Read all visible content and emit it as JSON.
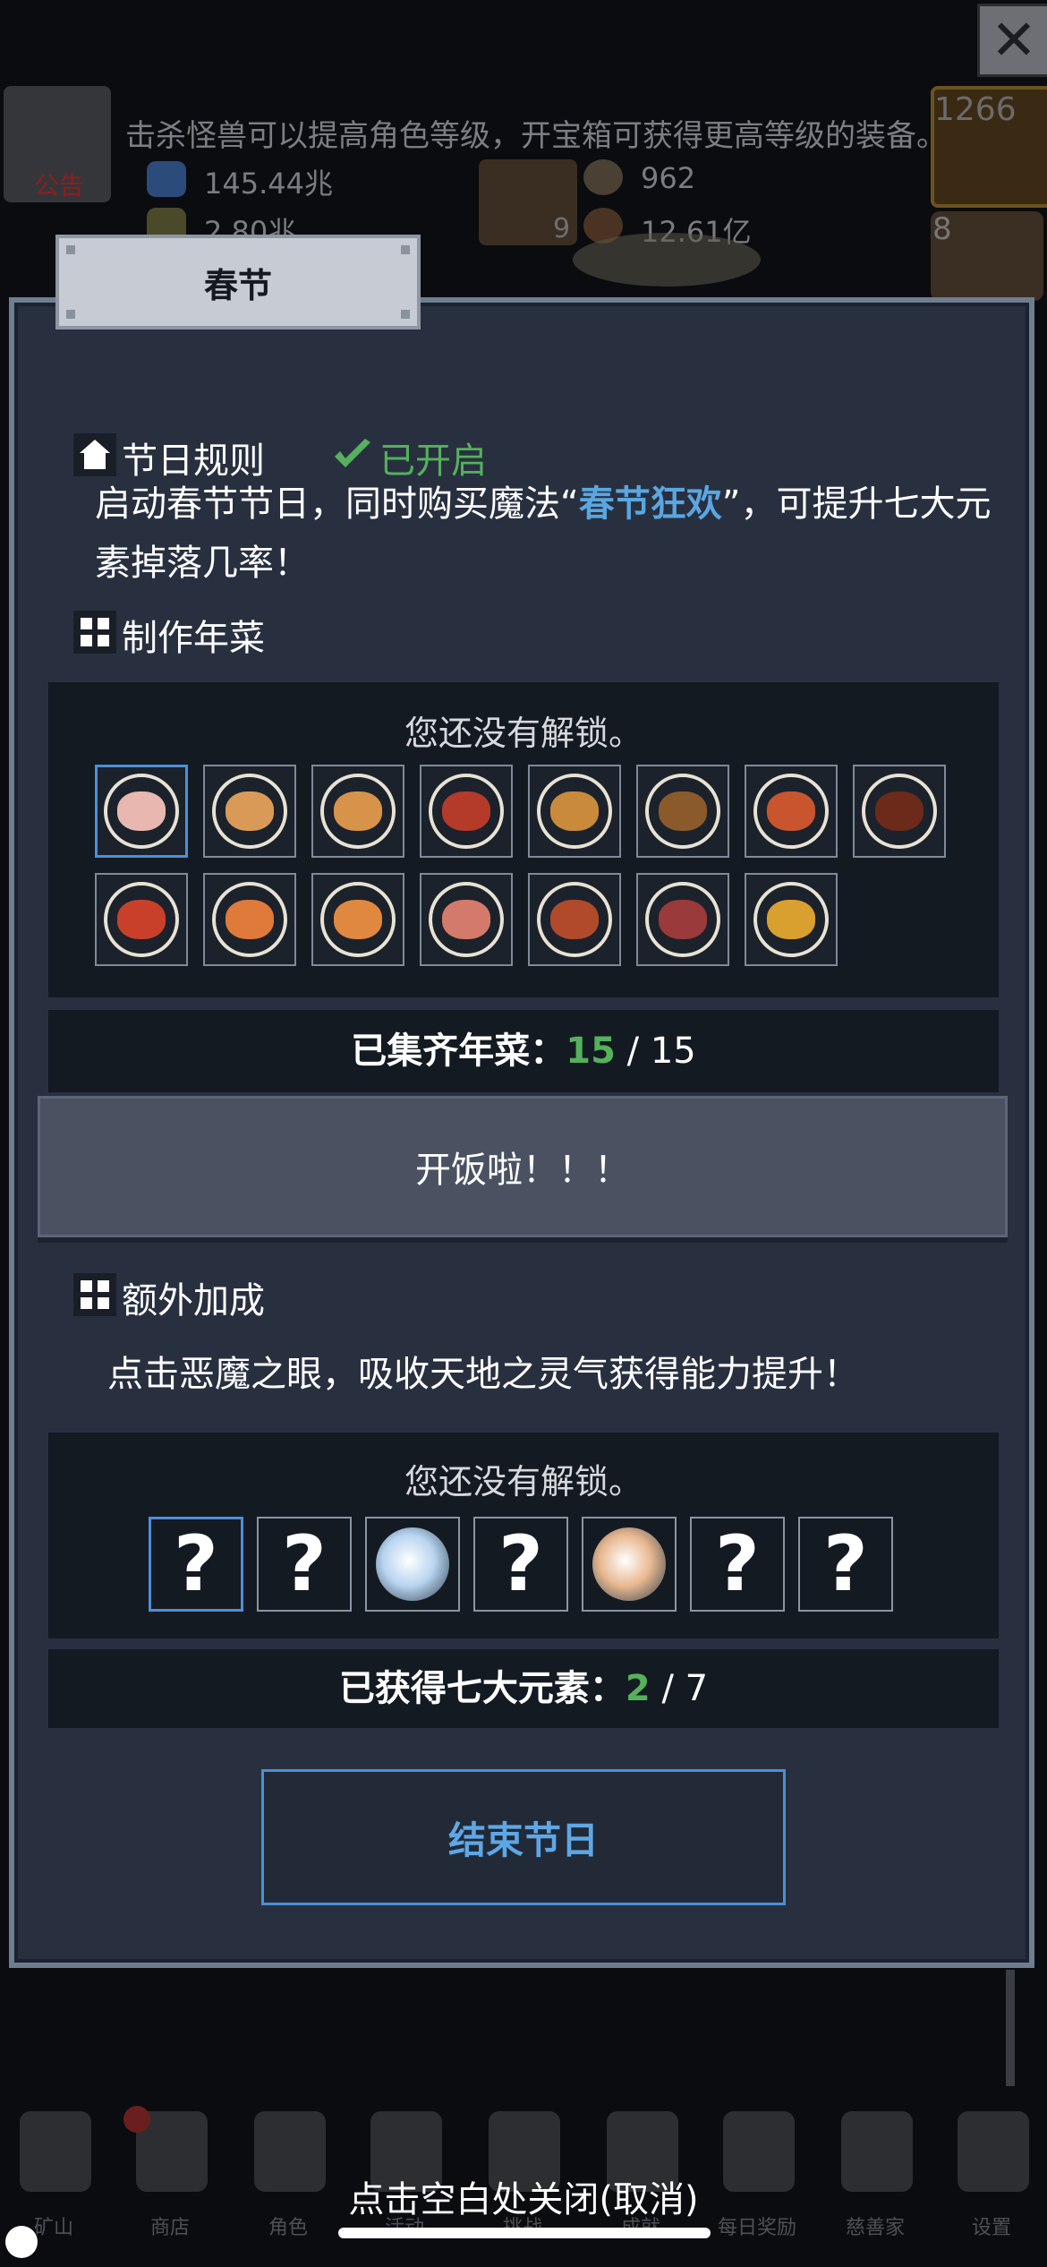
{
  "hud": {
    "tip": "击杀怪兽可以提高角色等级，开宝箱可获得更高等级的装备。",
    "notice_label": "公告",
    "res1": "145.44兆",
    "res2": "2.80兆",
    "res3": "962",
    "res4": "12.61亿",
    "book_count": "9",
    "potion_count": "1266",
    "chest_count": "8",
    "close_label": "✕"
  },
  "modal": {
    "title": "春节",
    "rules": {
      "title": "节日规则",
      "status": "已开启",
      "text_before": "启动春节节日，同时购买魔法",
      "quote_open": "“",
      "highlight": "春节狂欢",
      "quote_close": "”",
      "text_after": "，可提升七大元素掉落几率！"
    },
    "dishes": {
      "title": "制作年菜",
      "locked_text": "您还没有解锁。",
      "count_label": "已集齐年菜：",
      "count_current": "15",
      "count_sep": " / ",
      "count_total": "15",
      "items": [
        {
          "name": "bun",
          "color": "#e8b8b0"
        },
        {
          "name": "dumplings-steamed",
          "color": "#d99a58"
        },
        {
          "name": "xiaolongbao",
          "color": "#d7934a"
        },
        {
          "name": "red-braise",
          "color": "#b43a2a"
        },
        {
          "name": "meatballs",
          "color": "#c98a3c"
        },
        {
          "name": "stir-fry-greens",
          "color": "#8a5a2a"
        },
        {
          "name": "shrimp-plate",
          "color": "#c8552e"
        },
        {
          "name": "braised-pork",
          "color": "#6b2a1a"
        },
        {
          "name": "tomato-dish",
          "color": "#c9402a"
        },
        {
          "name": "prawns",
          "color": "#e07a3a"
        },
        {
          "name": "pumpkin-soup",
          "color": "#e08840"
        },
        {
          "name": "shrimp-soup",
          "color": "#d47a6a"
        },
        {
          "name": "fish-stew",
          "color": "#b04a2a"
        },
        {
          "name": "steamed-fish",
          "color": "#9a3a3a"
        },
        {
          "name": "golden-soup",
          "color": "#d9a030"
        }
      ],
      "cook_button": "开饭啦！！！"
    },
    "bonus": {
      "title": "额外加成",
      "text": "点击恶魔之眼，吸收天地之灵气获得能力提升！",
      "locked_text": "您还没有解锁。",
      "unknown_mark": "?",
      "elements": [
        {
          "state": "unknown"
        },
        {
          "state": "unknown"
        },
        {
          "state": "owned",
          "color": "#b8d4f0"
        },
        {
          "state": "unknown"
        },
        {
          "state": "owned",
          "color": "#e8b890"
        },
        {
          "state": "unknown"
        },
        {
          "state": "unknown"
        }
      ],
      "count_label": "已获得七大元素：",
      "count_current": "2",
      "count_sep": " / ",
      "count_total": "7"
    },
    "end_button": "结束节日"
  },
  "nav": {
    "items": [
      {
        "label": "矿山",
        "icon": "lantern-icon"
      },
      {
        "label": "商店",
        "icon": "shop-bag-icon"
      },
      {
        "label": "角色",
        "icon": "skull-icon"
      },
      {
        "label": "活动",
        "icon": "scroll-icon"
      },
      {
        "label": "挑战",
        "icon": "map-icon"
      },
      {
        "label": "成就",
        "icon": "key-icon"
      },
      {
        "label": "每日奖励",
        "icon": "letter-icon"
      },
      {
        "label": "慈善家",
        "icon": "bread-icon"
      },
      {
        "label": "设置",
        "icon": "gear-icon"
      }
    ],
    "close_hint": "点击空白处关闭(取消)"
  }
}
